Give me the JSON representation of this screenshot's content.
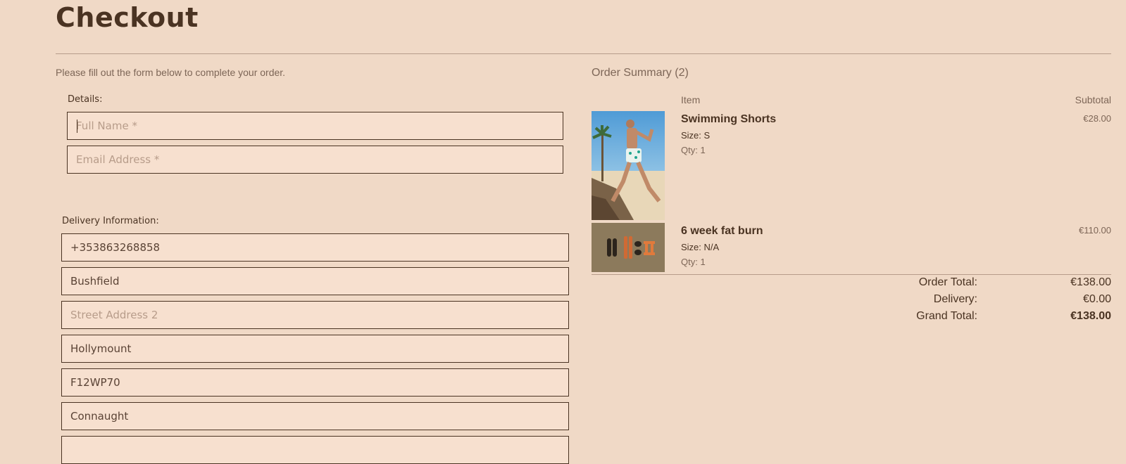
{
  "page": {
    "title": "Checkout",
    "intro": "Please fill out the form below to complete your order."
  },
  "details": {
    "legend": "Details:",
    "full_name_placeholder": "Full Name *",
    "email_placeholder": "Email Address *"
  },
  "delivery": {
    "legend": "Delivery Information:",
    "phone": "+353863268858",
    "street1": "Bushfield",
    "street2_placeholder": "Street Address 2",
    "town": "Hollymount",
    "postcode": "F12WP70",
    "county": "Connaught"
  },
  "summary": {
    "title": "Order Summary (2)",
    "col_item": "Item",
    "col_subtotal": "Subtotal",
    "items": [
      {
        "name": "Swimming Shorts",
        "size": "Size: S",
        "qty": "Qty: 1",
        "price": "€28.00",
        "image": "beach-man-photo"
      },
      {
        "name": "6 week fat burn",
        "size": "Size: N/A",
        "qty": "Qty: 1",
        "price": "€110.00",
        "image": "dumbbells-photo"
      }
    ],
    "order_total_label": "Order Total:",
    "order_total": "€138.00",
    "delivery_label": "Delivery:",
    "delivery": "€0.00",
    "grand_total_label": "Grand Total:",
    "grand_total": "€138.00"
  },
  "colors": {
    "background": "#f0d9c6",
    "field_background": "#f7e0cf",
    "text_dark": "#4a3322",
    "text_muted": "#7d6657"
  }
}
